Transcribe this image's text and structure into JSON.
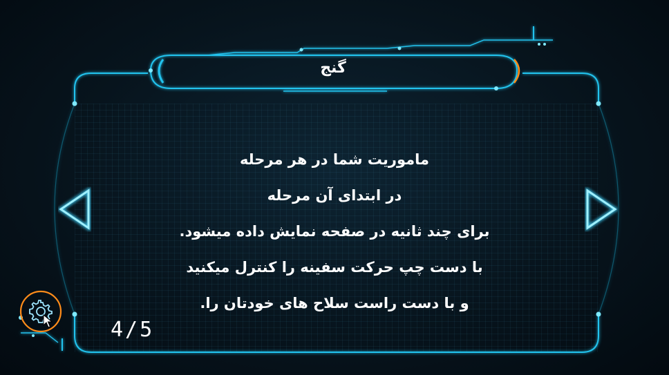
{
  "screen": {
    "title": "گنج",
    "instructions": [
      "ماموریت شما در هر مرحله",
      "در ابتدای آن مرحله",
      "برای چند ثانیه در صفحه نمایش داده میشود.",
      "با دست چپ حرکت سفینه را کنترل میکنید",
      "و با دست راست سلاح های خودتان را."
    ]
  },
  "pagination": {
    "indicator": "4/5",
    "current": 4,
    "total": 5
  },
  "controls": {
    "prev": "left-arrow-icon",
    "next": "right-arrow-icon",
    "settings": "gear-icon"
  },
  "colors": {
    "glow": "#3fd6ff",
    "frame": "#1fb8e6",
    "accent": "#ff8c1a",
    "text": "#ffffff"
  }
}
